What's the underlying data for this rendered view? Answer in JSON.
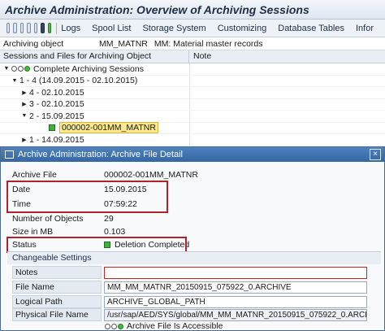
{
  "window": {
    "title": "Archive Administration: Overview of Archiving Sessions"
  },
  "toolbar": {
    "buttons": [
      "Logs",
      "Spool List",
      "Storage System",
      "Customizing",
      "Database Tables",
      "Infor"
    ]
  },
  "archiving_object": {
    "label": "Archiving object",
    "value": "MM_MATNR",
    "desc": "MM: Material master records"
  },
  "tree": {
    "headers": [
      "Sessions and Files for Archiving Object",
      "Note"
    ],
    "rows": [
      {
        "text": "Complete Archiving Sessions"
      },
      {
        "text": "1 - 4 (14.09.2015 - 02.10.2015)"
      },
      {
        "text": "4 - 02.10.2015"
      },
      {
        "text": "3 - 02.10.2015"
      },
      {
        "text": "2 - 15.09.2015"
      },
      {
        "text": "000002-001MM_MATNR"
      },
      {
        "text": "1 - 14.09.2015"
      }
    ]
  },
  "dialog": {
    "title": "Archive Administration: Archive File Detail",
    "close": "×",
    "fields": {
      "archive_file": {
        "label": "Archive File",
        "value": "000002-001MM_MATNR"
      },
      "date": {
        "label": "Date",
        "value": "15.09.2015"
      },
      "time": {
        "label": "Time",
        "value": "07:59:22"
      },
      "num_objects": {
        "label": "Number of Objects",
        "value": "29"
      },
      "size_mb": {
        "label": "Size in MB",
        "value": "0.103"
      },
      "status": {
        "label": "Status",
        "value": "Deletion Completed"
      }
    },
    "changeable": {
      "title": "Changeable Settings",
      "notes": {
        "label": "Notes",
        "value": ""
      },
      "file_name": {
        "label": "File Name",
        "value": "MM_MM_MATNR_20150915_075922_0.ARCHIVE"
      },
      "logical_path": {
        "label": "Logical Path",
        "value": "ARCHIVE_GLOBAL_PATH"
      },
      "physical_file_name": {
        "label": "Physical File Name",
        "value": "/usr/sap/AED/SYS/global/MM_MM_MATNR_20150915_075922_0.ARCHI"
      },
      "accessible": {
        "value": "Archive File Is Accessible"
      }
    }
  },
  "colors": {
    "highlight_box": "#b0232a",
    "status_green": "#3cb43a",
    "dialog_title": "#3467a3"
  }
}
